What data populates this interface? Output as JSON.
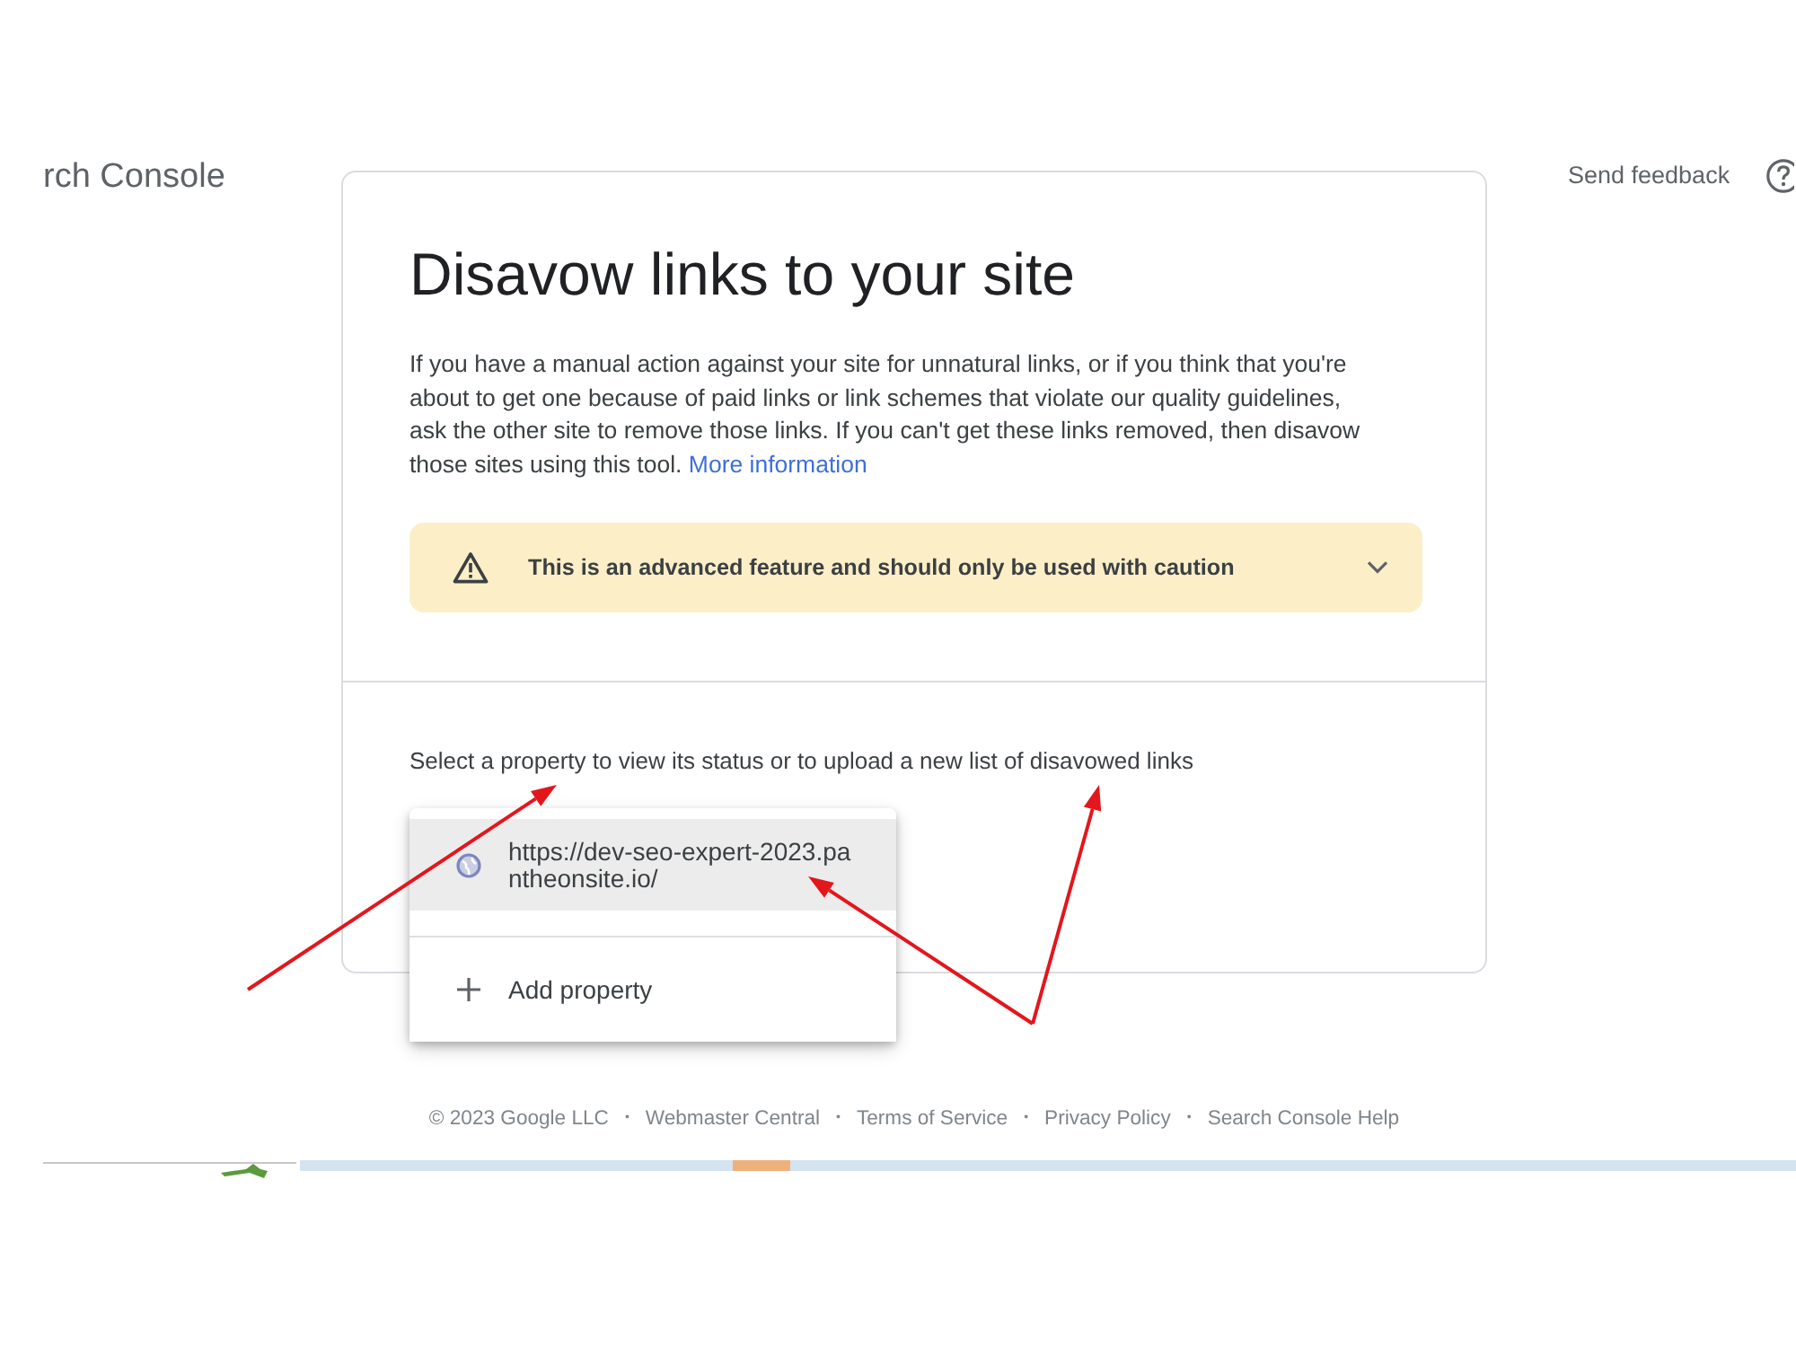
{
  "header": {
    "product_name": "rch Console",
    "feedback_link": "Send feedback"
  },
  "card": {
    "title": "Disavow links to your site",
    "description": "If you have a manual action against your site for unnatural links, or if you think that you're about to get one because of paid links or link schemes that violate our quality guidelines, ask the other site to remove those links. If you can't get these links removed, then disavow those sites using this tool.",
    "more_link": "More information",
    "warning": {
      "text": "This is an advanced feature and should only be used with caution",
      "expanded": false
    },
    "prompt": "Select a property to view its status or to upload a new list of disavowed links"
  },
  "property_menu": {
    "items": [
      {
        "kind": "property",
        "label": "https://dev-seo-expert-2023.pantheonsite.io/",
        "selected": true
      },
      {
        "kind": "add",
        "label": "Add property",
        "selected": false
      }
    ]
  },
  "footer": {
    "separator": "•",
    "items": [
      "© 2023 Google LLC",
      "Webmaster Central",
      "Terms of Service",
      "Privacy Policy",
      "Search Console Help"
    ]
  }
}
